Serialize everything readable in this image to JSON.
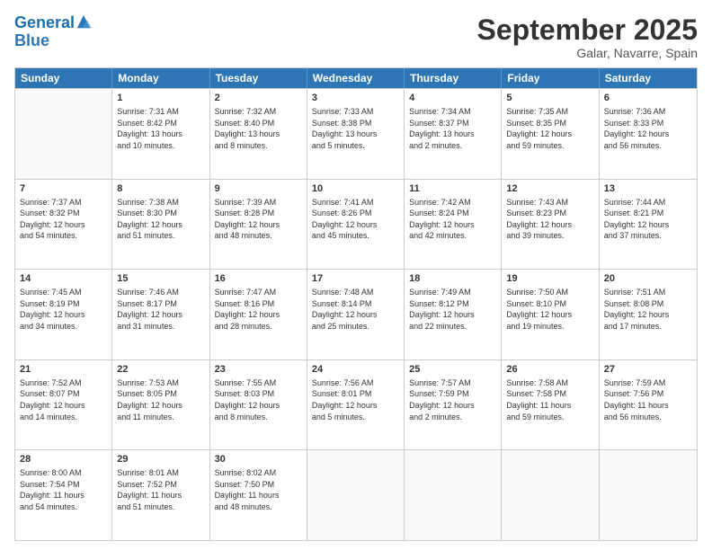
{
  "logo": {
    "line1": "General",
    "line2": "Blue"
  },
  "title": "September 2025",
  "subtitle": "Galar, Navarre, Spain",
  "header_days": [
    "Sunday",
    "Monday",
    "Tuesday",
    "Wednesday",
    "Thursday",
    "Friday",
    "Saturday"
  ],
  "weeks": [
    [
      {
        "day": "",
        "info": ""
      },
      {
        "day": "1",
        "info": "Sunrise: 7:31 AM\nSunset: 8:42 PM\nDaylight: 13 hours\nand 10 minutes."
      },
      {
        "day": "2",
        "info": "Sunrise: 7:32 AM\nSunset: 8:40 PM\nDaylight: 13 hours\nand 8 minutes."
      },
      {
        "day": "3",
        "info": "Sunrise: 7:33 AM\nSunset: 8:38 PM\nDaylight: 13 hours\nand 5 minutes."
      },
      {
        "day": "4",
        "info": "Sunrise: 7:34 AM\nSunset: 8:37 PM\nDaylight: 13 hours\nand 2 minutes."
      },
      {
        "day": "5",
        "info": "Sunrise: 7:35 AM\nSunset: 8:35 PM\nDaylight: 12 hours\nand 59 minutes."
      },
      {
        "day": "6",
        "info": "Sunrise: 7:36 AM\nSunset: 8:33 PM\nDaylight: 12 hours\nand 56 minutes."
      }
    ],
    [
      {
        "day": "7",
        "info": "Sunrise: 7:37 AM\nSunset: 8:32 PM\nDaylight: 12 hours\nand 54 minutes."
      },
      {
        "day": "8",
        "info": "Sunrise: 7:38 AM\nSunset: 8:30 PM\nDaylight: 12 hours\nand 51 minutes."
      },
      {
        "day": "9",
        "info": "Sunrise: 7:39 AM\nSunset: 8:28 PM\nDaylight: 12 hours\nand 48 minutes."
      },
      {
        "day": "10",
        "info": "Sunrise: 7:41 AM\nSunset: 8:26 PM\nDaylight: 12 hours\nand 45 minutes."
      },
      {
        "day": "11",
        "info": "Sunrise: 7:42 AM\nSunset: 8:24 PM\nDaylight: 12 hours\nand 42 minutes."
      },
      {
        "day": "12",
        "info": "Sunrise: 7:43 AM\nSunset: 8:23 PM\nDaylight: 12 hours\nand 39 minutes."
      },
      {
        "day": "13",
        "info": "Sunrise: 7:44 AM\nSunset: 8:21 PM\nDaylight: 12 hours\nand 37 minutes."
      }
    ],
    [
      {
        "day": "14",
        "info": "Sunrise: 7:45 AM\nSunset: 8:19 PM\nDaylight: 12 hours\nand 34 minutes."
      },
      {
        "day": "15",
        "info": "Sunrise: 7:46 AM\nSunset: 8:17 PM\nDaylight: 12 hours\nand 31 minutes."
      },
      {
        "day": "16",
        "info": "Sunrise: 7:47 AM\nSunset: 8:16 PM\nDaylight: 12 hours\nand 28 minutes."
      },
      {
        "day": "17",
        "info": "Sunrise: 7:48 AM\nSunset: 8:14 PM\nDaylight: 12 hours\nand 25 minutes."
      },
      {
        "day": "18",
        "info": "Sunrise: 7:49 AM\nSunset: 8:12 PM\nDaylight: 12 hours\nand 22 minutes."
      },
      {
        "day": "19",
        "info": "Sunrise: 7:50 AM\nSunset: 8:10 PM\nDaylight: 12 hours\nand 19 minutes."
      },
      {
        "day": "20",
        "info": "Sunrise: 7:51 AM\nSunset: 8:08 PM\nDaylight: 12 hours\nand 17 minutes."
      }
    ],
    [
      {
        "day": "21",
        "info": "Sunrise: 7:52 AM\nSunset: 8:07 PM\nDaylight: 12 hours\nand 14 minutes."
      },
      {
        "day": "22",
        "info": "Sunrise: 7:53 AM\nSunset: 8:05 PM\nDaylight: 12 hours\nand 11 minutes."
      },
      {
        "day": "23",
        "info": "Sunrise: 7:55 AM\nSunset: 8:03 PM\nDaylight: 12 hours\nand 8 minutes."
      },
      {
        "day": "24",
        "info": "Sunrise: 7:56 AM\nSunset: 8:01 PM\nDaylight: 12 hours\nand 5 minutes."
      },
      {
        "day": "25",
        "info": "Sunrise: 7:57 AM\nSunset: 7:59 PM\nDaylight: 12 hours\nand 2 minutes."
      },
      {
        "day": "26",
        "info": "Sunrise: 7:58 AM\nSunset: 7:58 PM\nDaylight: 11 hours\nand 59 minutes."
      },
      {
        "day": "27",
        "info": "Sunrise: 7:59 AM\nSunset: 7:56 PM\nDaylight: 11 hours\nand 56 minutes."
      }
    ],
    [
      {
        "day": "28",
        "info": "Sunrise: 8:00 AM\nSunset: 7:54 PM\nDaylight: 11 hours\nand 54 minutes."
      },
      {
        "day": "29",
        "info": "Sunrise: 8:01 AM\nSunset: 7:52 PM\nDaylight: 11 hours\nand 51 minutes."
      },
      {
        "day": "30",
        "info": "Sunrise: 8:02 AM\nSunset: 7:50 PM\nDaylight: 11 hours\nand 48 minutes."
      },
      {
        "day": "",
        "info": ""
      },
      {
        "day": "",
        "info": ""
      },
      {
        "day": "",
        "info": ""
      },
      {
        "day": "",
        "info": ""
      }
    ]
  ]
}
